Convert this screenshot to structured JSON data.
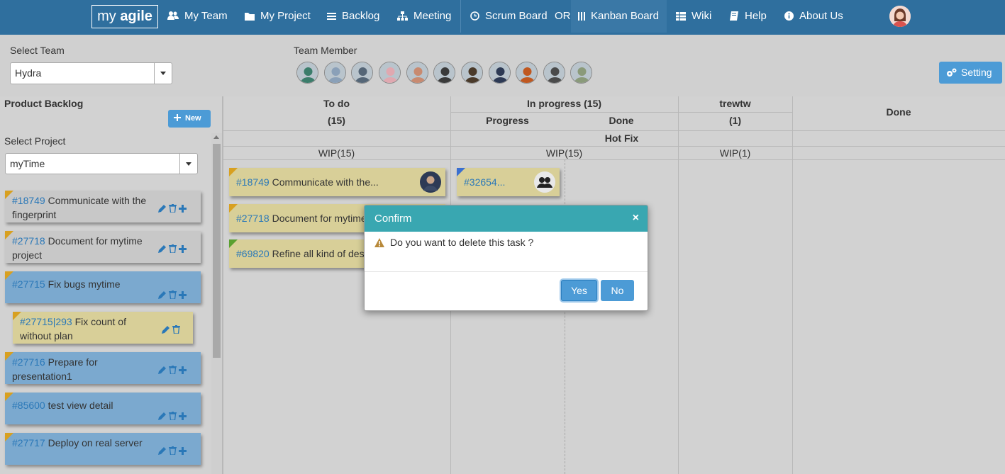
{
  "nav": {
    "logo_my": "my ",
    "logo_agile": "agile",
    "items": [
      {
        "label": "My Team",
        "icon": "users-icon"
      },
      {
        "label": "My Project",
        "icon": "folder-icon"
      },
      {
        "label": "Backlog",
        "icon": "list-icon"
      },
      {
        "label": "Meeting",
        "icon": "sitemap-icon"
      },
      {
        "label": "Scrum Board",
        "icon": "clock-icon"
      },
      {
        "label": "Kanban Board",
        "icon": "columns-icon"
      },
      {
        "label": "Wiki",
        "icon": "table-icon"
      },
      {
        "label": "Help",
        "icon": "book-icon"
      },
      {
        "label": "About Us",
        "icon": "info-icon"
      }
    ],
    "or_label": "OR",
    "active": "Kanban Board"
  },
  "team": {
    "select_label": "Select Team",
    "selected": "Hydra",
    "members_label": "Team Member",
    "member_colors": [
      "#3b7d6b",
      "#8aa0b8",
      "#556677",
      "#e0a8b0",
      "#c88a70",
      "#3a3a3a",
      "#4a3a2a",
      "#2d3a55",
      "#c05820",
      "#4a4a4a",
      "#8a9a7a"
    ],
    "setting_label": "Setting"
  },
  "backlog": {
    "title": "Product Backlog",
    "new_label": "New",
    "project_label": "Select Project",
    "project_selected": "myTime",
    "items": [
      {
        "id": "#18749",
        "text": "Communicate with the fingerprint",
        "color": "grey",
        "sub": false
      },
      {
        "id": "#27718",
        "text": "Document for mytime project",
        "color": "grey",
        "sub": false
      },
      {
        "id": "#27715",
        "text": "Fix bugs mytime",
        "color": "blue",
        "sub": false
      },
      {
        "id": "#27715|293",
        "text": "Fix count of without plan",
        "color": "yellow",
        "sub": true
      },
      {
        "id": "#27716",
        "text": "Prepare for presentation1",
        "color": "blue",
        "sub": false
      },
      {
        "id": "#85600",
        "text": "test view detail",
        "color": "blue",
        "sub": false
      },
      {
        "id": "#27717",
        "text": "Deploy on real server",
        "color": "blue",
        "sub": false
      }
    ]
  },
  "board": {
    "columns": {
      "todo": {
        "title": "To do",
        "count": "(15)",
        "wip": "WIP(15)"
      },
      "inprogress": {
        "title": "In progress (15)",
        "sub_progress": "Progress",
        "sub_done": "Done",
        "wip": "WIP(15)"
      },
      "trewtw": {
        "title": "trewtw",
        "count": "(1)",
        "wip": "WIP(1)"
      },
      "done": {
        "title": "Done"
      }
    },
    "swimlane": "Hot Fix",
    "todo_cards": [
      {
        "id": "#18749",
        "text": "Communicate with the...",
        "corner": "#d8a020"
      },
      {
        "id": "#27718",
        "text": "Document for mytime project",
        "corner": "#d8a020"
      },
      {
        "id": "#69820",
        "text": "Refine all kind of design",
        "corner": "#5aa030"
      }
    ],
    "progress_cards": [
      {
        "id": "#32654",
        "text": "...",
        "corner": "#3a6fd0"
      }
    ]
  },
  "modal": {
    "title": "Confirm",
    "close": "×",
    "message": "Do you want to delete this task ?",
    "yes": "Yes",
    "no": "No"
  }
}
